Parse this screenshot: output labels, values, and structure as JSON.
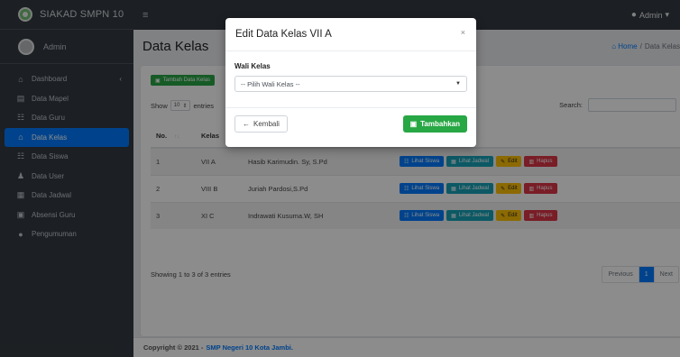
{
  "app": {
    "brand": "SIAKAD SMPN 10",
    "user": "Admin"
  },
  "sidebar": {
    "items": [
      {
        "label": "Dashboard",
        "icon": "dashboard-icon",
        "glyph": "⌂"
      },
      {
        "label": "Data Mapel",
        "icon": "book-icon",
        "glyph": "▤"
      },
      {
        "label": "Data Guru",
        "icon": "users-icon",
        "glyph": "☷"
      },
      {
        "label": "Data Kelas",
        "icon": "home-icon",
        "glyph": "⌂",
        "active": true
      },
      {
        "label": "Data Siswa",
        "icon": "users-icon",
        "glyph": "☷"
      },
      {
        "label": "Data User",
        "icon": "user-plus-icon",
        "glyph": "♟"
      },
      {
        "label": "Data Jadwal",
        "icon": "calendar-icon",
        "glyph": "▦"
      },
      {
        "label": "Absensi Guru",
        "icon": "calendar-check-icon",
        "glyph": "▣"
      },
      {
        "label": "Pengumuman",
        "icon": "info-icon",
        "glyph": "●"
      }
    ]
  },
  "navbar": {
    "menu_glyph": "≡",
    "admin_label": "Admin",
    "admin_caret": "▾"
  },
  "page": {
    "title": "Data Kelas",
    "breadcrumb_home": "Home",
    "breadcrumb_sep": "/",
    "breadcrumb_current": "Data Kelas"
  },
  "toolbar": {
    "add_label": "Tambah Data Kelas"
  },
  "table_controls": {
    "show_label": "Show",
    "show_value": "10",
    "entries_label": "entries",
    "search_label": "Search:"
  },
  "table": {
    "headers": [
      "No.",
      "Kelas",
      "",
      ""
    ],
    "rows": [
      {
        "no": "1",
        "kelas": "VII A",
        "wali": "Hasib Karimudin. Sy, S.Pd"
      },
      {
        "no": "2",
        "kelas": "VIII B",
        "wali": "Juriah Pardosi,S.Pd"
      },
      {
        "no": "3",
        "kelas": "XI C",
        "wali": "Indrawati Kusuma.W, SH"
      }
    ],
    "actions": {
      "lihat_siswa": "Lihat Siswa",
      "lihat_jadwal": "Lihat Jadwal",
      "edit": "Edit",
      "hapus": "Hapus"
    }
  },
  "pagination": {
    "info": "Showing 1 to 3 of 3 entries",
    "previous": "Previous",
    "current": "1",
    "next": "Next"
  },
  "footer": {
    "copyright": "Copyright © 2021 -",
    "org": "SMP Negeri 10 Kota Jambi."
  },
  "modal": {
    "title": "Edit Data Kelas VII A",
    "close_glyph": "×",
    "field_label": "Wali Kelas",
    "select_value": "-- Pilih Wali Kelas --",
    "back_label": "Kembali",
    "submit_label": "Tambahkan"
  },
  "colors": {
    "primary": "#007bff",
    "success": "#28a745",
    "info": "#17a2b8",
    "warning": "#ffc107",
    "danger": "#dc3545",
    "sidebar": "#343a40"
  }
}
